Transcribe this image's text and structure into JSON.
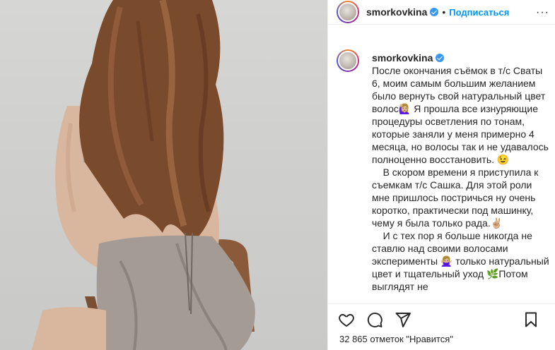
{
  "post": {
    "username": "smorkovkina",
    "separator": "•",
    "follow_label": "Подписаться",
    "more_label": "···",
    "caption_user": "smorkovkina",
    "caption_text": "\nПосле окончания съёмок в т/с Сваты 6, моим самым большим желанием было вернуть свой натуральный цвет волос🙋🏼‍♀️ Я прошла все изнуряющие процедуры осветления по тонам, которые заняли у меня примерно 4 месяца, но волосы так и не удавалось полноценно восстановить. 😉\n    В скором времени я приступила к съемкам т/с Сашка. Для этой роли мне пришлось постричься ну очень коротко, практически под машинку, чему я была только рада.✌🏼\n    И с тех пор я больше никогда не ставлю над своими волосами эксперименты 🙅🏼‍♀️ только натуральный цвет и тщательный уход 🌿Потом выглядят не",
    "likes_text": "32 865 отметок \"Нравится\""
  },
  "icons": {
    "like": "heart-icon",
    "comment": "comment-icon",
    "share": "share-icon",
    "save": "bookmark-icon",
    "verified": "verified-badge-icon"
  },
  "colors": {
    "accent": "#0095f6",
    "verified": "#3897f0",
    "text": "#262626"
  }
}
